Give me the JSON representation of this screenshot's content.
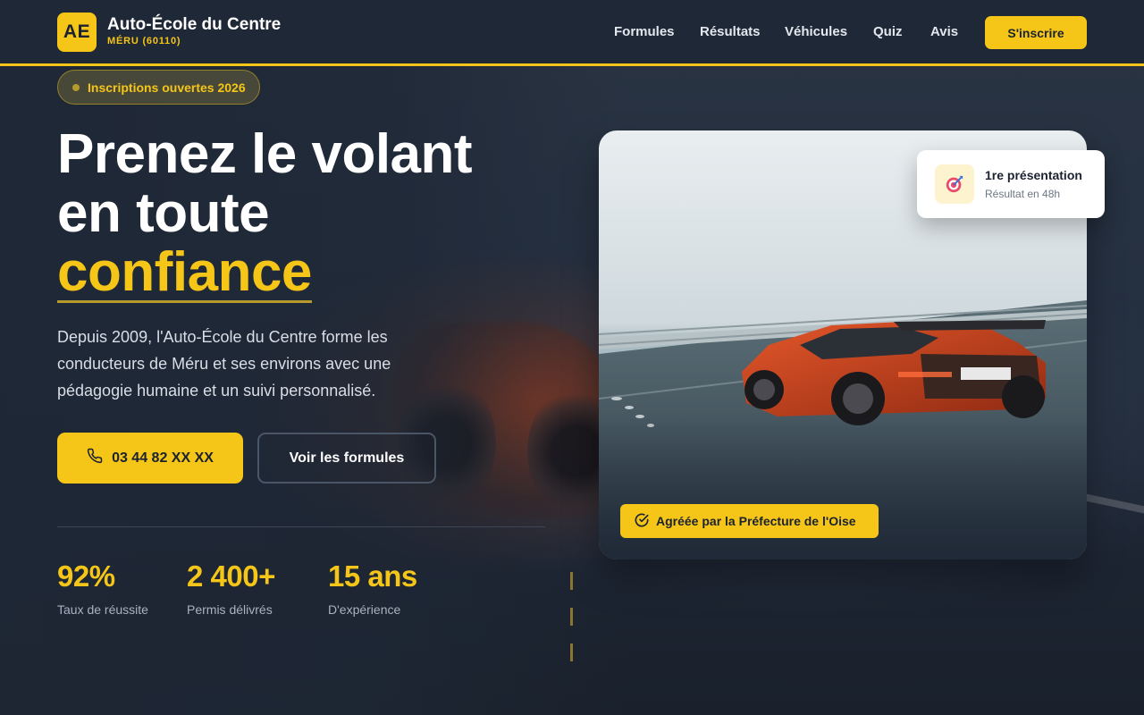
{
  "brand": {
    "logo": "AE",
    "name": "Auto-École du Centre",
    "city": "MÉRU (60110)"
  },
  "nav": {
    "items": [
      "Formules",
      "Résultats",
      "Véhicules",
      "Quiz",
      "Avis"
    ],
    "cta": "S'inscrire"
  },
  "hero": {
    "badge": "Inscriptions ouvertes 2026",
    "title_line1": "Prenez le volant",
    "title_line2": "en toute",
    "title_accent": "confiance",
    "lead": "Depuis 2009, l'Auto-École du Centre forme les conducteurs de Méru et ses environs avec une pédagogie humaine et un suivi personnalisé.",
    "phone_button": "03 44 82 XX XX",
    "formules_button": "Voir les formules"
  },
  "stats": [
    {
      "value": "92%",
      "label": "Taux de réussite"
    },
    {
      "value": "2 400+",
      "label": "Permis délivrés"
    },
    {
      "value": "15 ans",
      "label": "D'expérience"
    }
  ],
  "card": {
    "badge": "Agréée par la Préfecture de l'Oise",
    "float_title": "1re présentation",
    "float_subtitle": "Résultat en 48h"
  },
  "icons": {
    "phone": "phone-icon",
    "check": "check-circle-icon",
    "target": "target-icon"
  },
  "colors": {
    "accent": "#f5c518",
    "background": "#1e2735",
    "text": "#ffffff"
  }
}
